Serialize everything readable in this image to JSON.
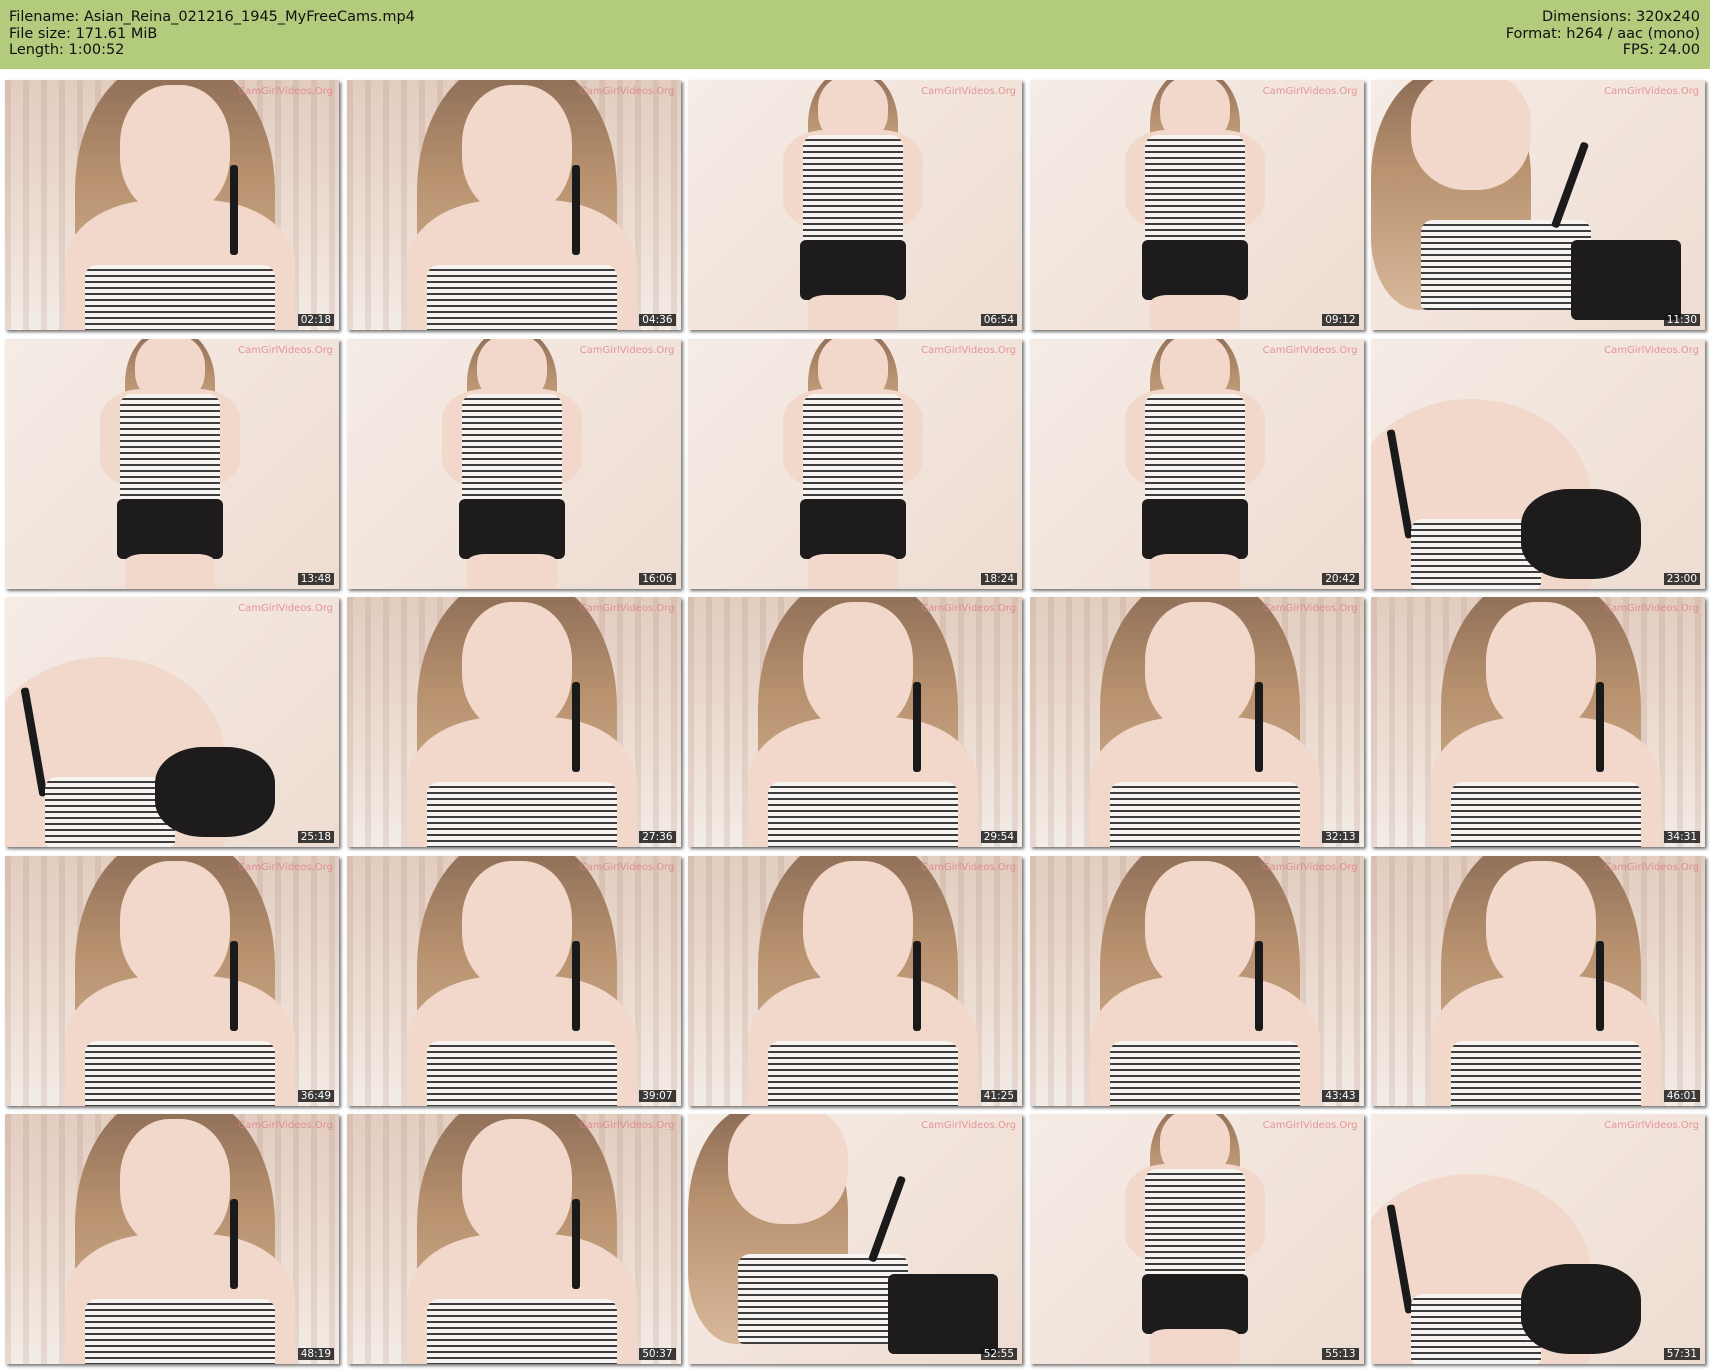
{
  "header": {
    "filename": "Filename: Asian_Reina_021216_1945_MyFreeCams.mp4",
    "filesize": "File size: 171.61 MiB",
    "length": "Length: 1:00:52",
    "dimensions": "Dimensions: 320x240",
    "format": "Format: h264 / aac (mono)",
    "fps": "FPS: 24.00",
    "background_color": "#b3cb7d"
  },
  "thumbnails": [
    {
      "timestamp": "02:18",
      "watermark": "CamGirlVideos.Org"
    },
    {
      "timestamp": "04:36",
      "watermark": "CamGirlVideos.Org"
    },
    {
      "timestamp": "06:54",
      "watermark": "CamGirlVideos.Org"
    },
    {
      "timestamp": "09:12",
      "watermark": "CamGirlVideos.Org"
    },
    {
      "timestamp": "11:30",
      "watermark": "CamGirlVideos.Org"
    },
    {
      "timestamp": "13:48",
      "watermark": "CamGirlVideos.Org"
    },
    {
      "timestamp": "16:06",
      "watermark": "CamGirlVideos.Org"
    },
    {
      "timestamp": "18:24",
      "watermark": "CamGirlVideos.Org"
    },
    {
      "timestamp": "20:42",
      "watermark": "CamGirlVideos.Org"
    },
    {
      "timestamp": "23:00",
      "watermark": "CamGirlVideos.Org"
    },
    {
      "timestamp": "25:18",
      "watermark": "CamGirlVideos.Org"
    },
    {
      "timestamp": "27:36",
      "watermark": "CamGirlVideos.Org"
    },
    {
      "timestamp": "29:54",
      "watermark": "CamGirlVideos.Org"
    },
    {
      "timestamp": "32:13",
      "watermark": "CamGirlVideos.Org"
    },
    {
      "timestamp": "34:31",
      "watermark": "CamGirlVideos.Org"
    },
    {
      "timestamp": "36:49",
      "watermark": "CamGirlVideos.Org"
    },
    {
      "timestamp": "39:07",
      "watermark": "CamGirlVideos.Org"
    },
    {
      "timestamp": "41:25",
      "watermark": "CamGirlVideos.Org"
    },
    {
      "timestamp": "43:43",
      "watermark": "CamGirlVideos.Org"
    },
    {
      "timestamp": "46:01",
      "watermark": "CamGirlVideos.Org"
    },
    {
      "timestamp": "48:19",
      "watermark": "CamGirlVideos.Org"
    },
    {
      "timestamp": "50:37",
      "watermark": "CamGirlVideos.Org"
    },
    {
      "timestamp": "52:55",
      "watermark": "CamGirlVideos.Org"
    },
    {
      "timestamp": "55:13",
      "watermark": "CamGirlVideos.Org"
    },
    {
      "timestamp": "57:31",
      "watermark": "CamGirlVideos.Org"
    }
  ]
}
